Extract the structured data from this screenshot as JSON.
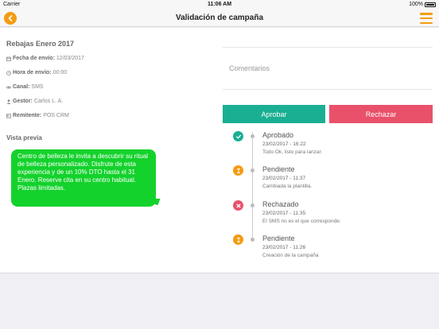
{
  "status_bar": {
    "carrier": "Carrier",
    "time": "11:06 AM",
    "battery": "100%"
  },
  "nav": {
    "title": "Validación de campaña",
    "back_icon": "chevron-left-icon",
    "menu_icon": "hamburger-menu-icon"
  },
  "campaign": {
    "title": "Rebajas Enero 2017",
    "fields": [
      {
        "label": "Fecha de envío:",
        "value": "12/03/2017",
        "icon": "calendar-icon"
      },
      {
        "label": "Hora de envío:",
        "value": "00:00",
        "icon": "clock-icon"
      },
      {
        "label": "Canal:",
        "value": "SMS",
        "icon": "link-icon"
      },
      {
        "label": "Gestor:",
        "value": "Carlos L. A.",
        "icon": "user-icon"
      },
      {
        "label": "Remitente:",
        "value": "POS CRM",
        "icon": "id-card-icon"
      }
    ]
  },
  "preview": {
    "label": "Vista previa",
    "message": "Centro de belleza le invita a descubrir su ritual de belleza personalizado. Disfrute de esta experiencia y de un 10% DTO hasta el 31 Enero. Reserve cita en su centro habitual. Plazas limitadas."
  },
  "comments": {
    "placeholder": "Comentarios"
  },
  "actions": {
    "approve": "Aprobar",
    "reject": "Rechazar"
  },
  "colors": {
    "accent": "#f39c12",
    "approve": "#1aaf93",
    "reject": "#e9516a",
    "bubble": "#14d22c"
  },
  "timeline": [
    {
      "status": "Aprobado",
      "date": "23/02/2017 - 16:22",
      "note": "Todo Ok, listo para lanzar.",
      "icon": "check-circle-icon",
      "color": "#1aaf93"
    },
    {
      "status": "Pendiente",
      "date": "23/02/2017 - 11:37",
      "note": "Cambiada la plantilla.",
      "icon": "hourglass-icon",
      "color": "#f39c12"
    },
    {
      "status": "Rechazado",
      "date": "23/02/2017 - 11:35",
      "note": "El SMS no es el que corresponde.",
      "icon": "x-circle-icon",
      "color": "#e9516a"
    },
    {
      "status": "Pendiente",
      "date": "23/02/2017 - 11:26",
      "note": "Creación de la campaña",
      "icon": "hourglass-icon",
      "color": "#f39c12"
    }
  ]
}
